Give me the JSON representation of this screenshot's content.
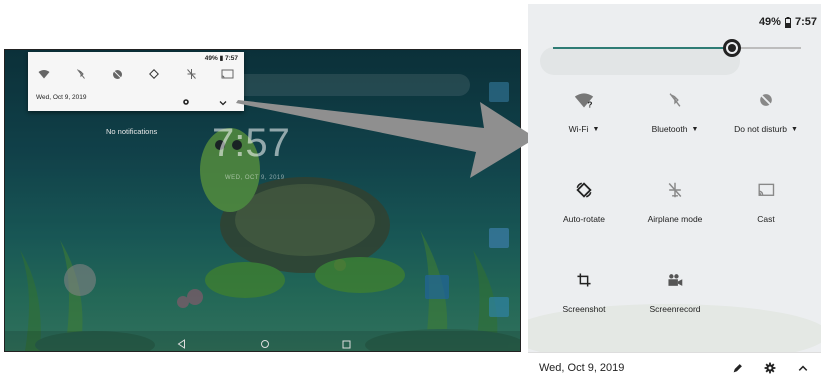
{
  "left_screen": {
    "status": "49% ▮ 7:57",
    "date": "Wed, Oct 9, 2019",
    "no_notifications": "No notifications",
    "lock_clock": "7:57",
    "lock_date": "WED, OCT 9, 2019",
    "mini_tiles": [
      "wifi-icon",
      "bluetooth-off-icon",
      "dnd-icon",
      "auto-rotate-icon",
      "airplane-icon",
      "cast-icon"
    ]
  },
  "panel": {
    "battery": "49%",
    "time": "7:57",
    "brightness": 0.72,
    "tiles": [
      {
        "label": "Wi-Fi",
        "icon": "wifi-question-icon",
        "dropdown": true
      },
      {
        "label": "Bluetooth",
        "icon": "bluetooth-off-icon",
        "dropdown": true
      },
      {
        "label": "Do not disturb",
        "icon": "dnd-off-icon",
        "dropdown": true
      },
      {
        "label": "Auto-rotate",
        "icon": "auto-rotate-icon",
        "dropdown": false
      },
      {
        "label": "Airplane mode",
        "icon": "airplane-off-icon",
        "dropdown": false
      },
      {
        "label": "Cast",
        "icon": "cast-icon",
        "dropdown": false
      },
      {
        "label": "Screenshot",
        "icon": "screenshot-icon",
        "dropdown": false
      },
      {
        "label": "Screenrecord",
        "icon": "screenrecord-icon",
        "dropdown": false
      }
    ],
    "footer_date": "Wed, Oct 9, 2019",
    "caret": "▼"
  },
  "colors": {
    "accent": "#2f7c75",
    "panel_bg": "#eceef0",
    "arrow": "#8f8f8f"
  }
}
